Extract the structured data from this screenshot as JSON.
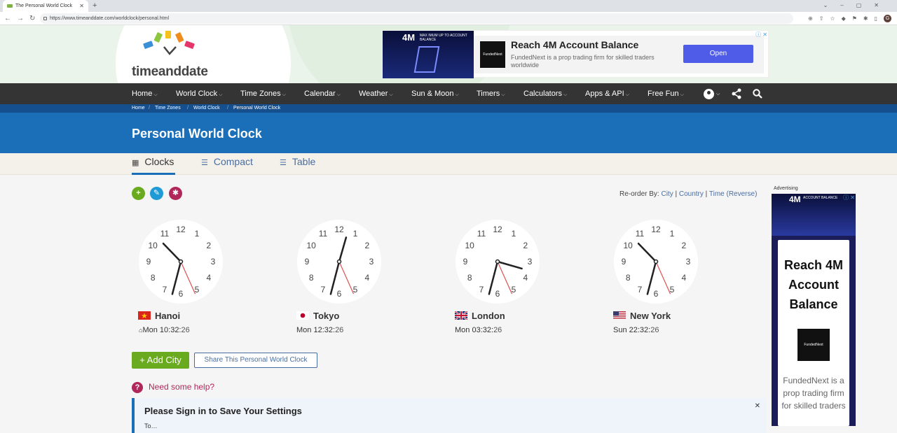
{
  "browser": {
    "tab_title": "The Personal World Clock",
    "url": "https://www.timeanddate.com/worldclock/personal.html",
    "profile_initial": "G"
  },
  "site": {
    "logo_text": "timeanddate",
    "ad": {
      "image_big": "4M",
      "image_small": "MAX IMUM UP TO\nACCOUNT BALANCE",
      "logo_text": "FundedNext",
      "title": "Reach 4M Account Balance",
      "desc": "FundedNext is a prop trading firm for skilled traders worldwide",
      "button": "Open"
    },
    "nav": [
      "Home",
      "World Clock",
      "Time Zones",
      "Calendar",
      "Weather",
      "Sun & Moon",
      "Timers",
      "Calculators",
      "Apps & API",
      "Free Fun"
    ],
    "breadcrumbs": [
      "Home",
      "Time Zones",
      "World Clock",
      "Personal World Clock"
    ],
    "page_title": "Personal World Clock",
    "tabs": [
      "Clocks",
      "Compact",
      "Table"
    ]
  },
  "reorder": {
    "label": "Re-order By:",
    "city": "City",
    "country": "Country",
    "time": "Time",
    "reverse": "(Reverse)"
  },
  "clocks": [
    {
      "city": "Hanoi",
      "day": "Mon",
      "hm": "10:32:",
      "sec": "26",
      "hour": 10,
      "minute": 32,
      "second": 26,
      "home": true
    },
    {
      "city": "Tokyo",
      "day": "Mon",
      "hm": "12:32:",
      "sec": "26",
      "hour": 12,
      "minute": 32,
      "second": 26,
      "home": false
    },
    {
      "city": "London",
      "day": "Mon",
      "hm": "03:32:",
      "sec": "26",
      "hour": 3,
      "minute": 32,
      "second": 26,
      "home": false
    },
    {
      "city": "New York",
      "day": "Sun",
      "hm": "22:32:",
      "sec": "26",
      "hour": 22,
      "minute": 32,
      "second": 26,
      "home": false
    }
  ],
  "buttons": {
    "add_city": "+ Add City",
    "share": "Share This Personal World Clock"
  },
  "help": "Need some help?",
  "signin": {
    "title": "Please Sign in to Save Your Settings",
    "body": "To…"
  },
  "sidead": {
    "label": "Advertising",
    "title": "Reach 4M Account Balance",
    "desc": "FundedNext is a prop trading firm for skilled traders",
    "logo_text": "FundedNext",
    "image_big": "4M",
    "image_small": "ACCOUNT BALANCE"
  },
  "colors": {
    "nav_bg": "#343434",
    "band_blue": "#1a6fb8",
    "crumb_blue": "#164f8d",
    "add_green": "#6aaa1e",
    "accent_pink": "#b0275a",
    "second_hand": "#e05050"
  }
}
